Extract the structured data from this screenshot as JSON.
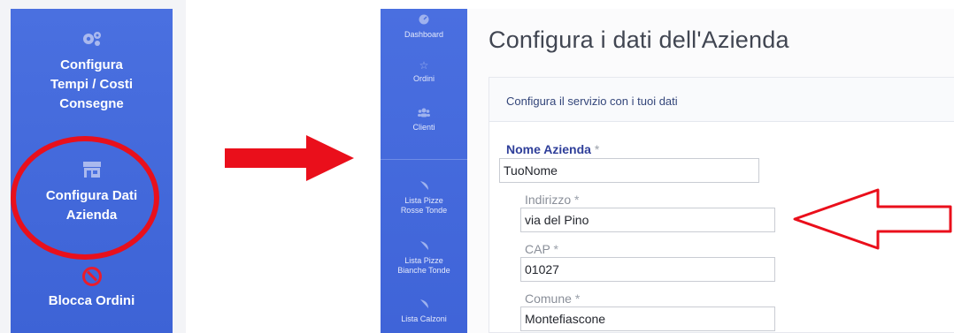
{
  "left_sidebar": {
    "items": [
      {
        "label_lines": [
          "Configura",
          "Tempi / Costi",
          "Consegne"
        ],
        "icon": "gears-icon"
      },
      {
        "label_lines": [
          "Configura Dati",
          "Azienda"
        ],
        "icon": "store-icon"
      },
      {
        "label_lines": [
          "Blocca Ordini"
        ],
        "icon": "block-icon"
      }
    ]
  },
  "app_nav": {
    "items": [
      {
        "label": "Dashboard",
        "icon": "dashboard-icon"
      },
      {
        "label": "Ordini",
        "icon": "star-icon"
      },
      {
        "label": "Clienti",
        "icon": "users-icon"
      },
      {
        "label_lines": [
          "Lista Pizze",
          "Rosse Tonde"
        ],
        "icon": "pizza-icon"
      },
      {
        "label_lines": [
          "Lista Pizze",
          "Bianche Tonde"
        ],
        "icon": "pizza-icon"
      },
      {
        "label": "Lista Calzoni",
        "icon": "pizza-icon"
      }
    ]
  },
  "main": {
    "title": "Configura i dati dell'Azienda",
    "card_header": "Configura il servizio con i tuoi dati",
    "fields": [
      {
        "label": "Nome Azienda",
        "required": "*",
        "value": "TuoNome"
      },
      {
        "label": "Indirizzo",
        "required": "*",
        "value": "via del Pino"
      },
      {
        "label": "CAP",
        "required": "*",
        "value": "01027"
      },
      {
        "label": "Comune",
        "required": "*",
        "value": "Montefiascone"
      }
    ]
  },
  "colors": {
    "sidebar_blue": "#4a70e0",
    "annotation_red": "#e8101c",
    "label_primary": "#2f3f9a"
  }
}
